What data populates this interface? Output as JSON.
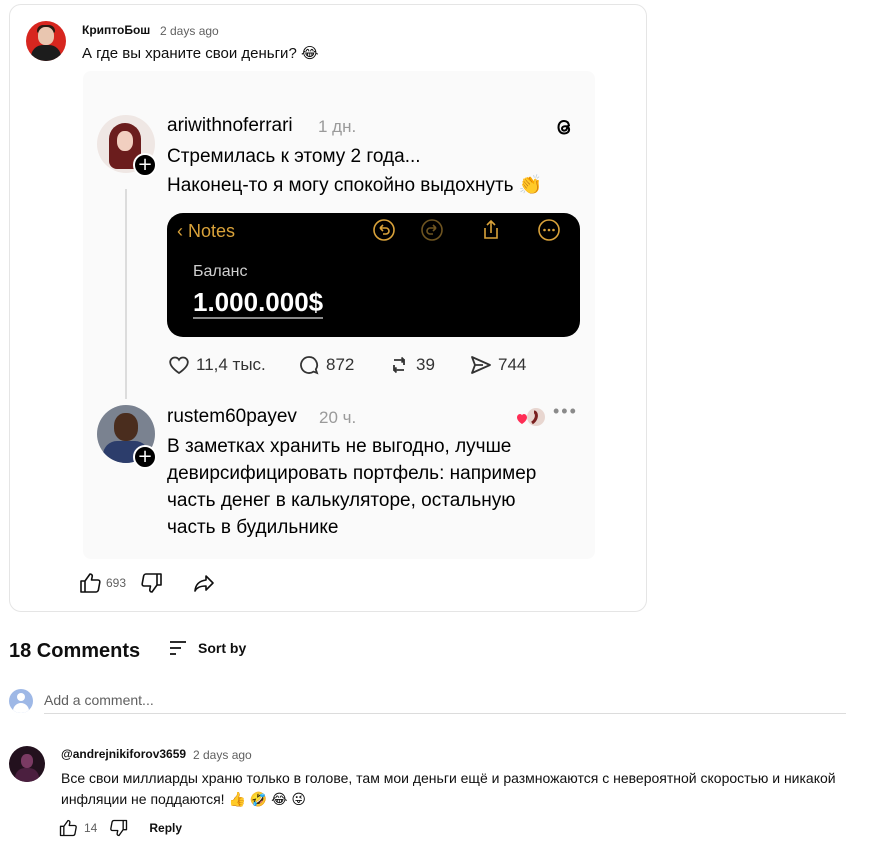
{
  "post": {
    "author": "КриптоБош",
    "time": "2 days ago",
    "text": "А где вы храните свои деньги? 😂",
    "likes": "693"
  },
  "thread_image": {
    "first": {
      "username": "ariwithnoferrari",
      "time": "1 дн.",
      "line1": "Стремилась к этому 2 года...",
      "line2": "Наконец-то я могу спокойно выдохнуть 👏",
      "notes": {
        "back_label": "Notes",
        "balance_label": "Баланс",
        "balance_value": "1.000.000$"
      },
      "stats": {
        "likes": "11,4 тыс.",
        "comments": "872",
        "reposts": "39",
        "shares": "744"
      }
    },
    "reply": {
      "username": "rustem60payev",
      "time": "20 ч.",
      "line1": "В заметках хранить не выгодно, лучше",
      "line2": "девирсифицировать портфель: например",
      "line3": "часть денег в калькуляторе, остальную",
      "line4": "часть в будильнике",
      "more": "•••"
    }
  },
  "comments_section": {
    "count_label": "18 Comments",
    "sort_label": "Sort by",
    "add_placeholder": "Add a comment..."
  },
  "comments": [
    {
      "author": "@andrejnikiforov3659",
      "time": "2 days ago",
      "text": "Все свои миллиарды храню только в голове, там мои деньги ещё и размножаются с невероятной скоростью и никакой инфляции не поддаются! 👍 🤣 😂 😜",
      "likes": "14",
      "reply_label": "Reply"
    }
  ],
  "colors": {
    "notes_accent": "#d9a23a",
    "author_avatar_bg": "#d7261f"
  }
}
